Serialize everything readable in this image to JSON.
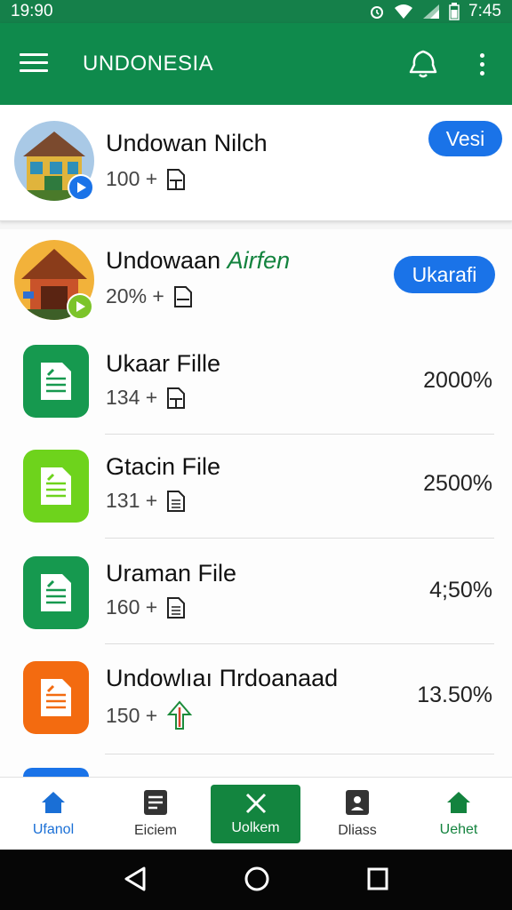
{
  "status_bar": {
    "time_left": "19:90",
    "time_right": "7:45"
  },
  "app_bar": {
    "title": "UNDONESIA",
    "icons": [
      "menu-icon",
      "bell-icon",
      "more-vert-icon"
    ]
  },
  "featured": [
    {
      "title": "Undowan Nilch",
      "subtitle": "100 +",
      "action": "Vesi",
      "badge_color": "#1a73e8"
    },
    {
      "title_plain": "Undowaan",
      "title_accent": "Airfen",
      "subtitle": "20% +",
      "action": "Ukarafi",
      "badge_color": "#7cc42a"
    }
  ],
  "files": [
    {
      "title": "Ukaar Fille",
      "count": "134 +",
      "percent": "2000%",
      "icon_color": "#16994f"
    },
    {
      "title": "Gtacin File",
      "count": "131 +",
      "percent": "2500%",
      "icon_color": "#6ed31c"
    },
    {
      "title": "Uraman File",
      "count": "160 +",
      "percent": "4;50%",
      "icon_color": "#16994f"
    },
    {
      "title": "Undowlıaı Πrdoanaad",
      "count": "150 +",
      "percent": "13.50%",
      "icon_color": "#f36b10"
    }
  ],
  "bottom_nav": [
    {
      "label": "Ufanol",
      "icon": "home-icon",
      "color": "#1a6fd6"
    },
    {
      "label": "Eiciem",
      "icon": "list-icon",
      "color": "#333333"
    },
    {
      "label": "Uolkem",
      "icon": "close-icon",
      "active": true
    },
    {
      "label": "Dliass",
      "icon": "contact-icon",
      "color": "#333333"
    },
    {
      "label": "Uehet",
      "icon": "home-icon",
      "color": "#13833e"
    }
  ],
  "colors": {
    "primary": "#0f8a4c",
    "accent_blue": "#1a73e8"
  }
}
